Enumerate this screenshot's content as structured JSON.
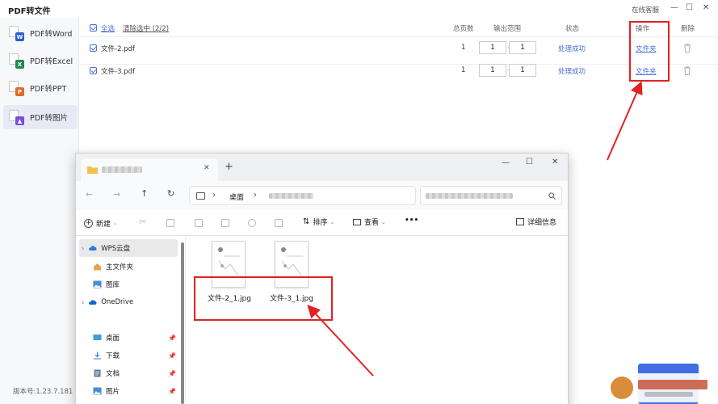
{
  "app": {
    "title": "PDF转文件",
    "online_service": "在线客服",
    "version": "版本号:1.23.7.181"
  },
  "sidebar": {
    "items": [
      {
        "label": "PDF转Word",
        "badge": "W",
        "color": "#2b5fd6"
      },
      {
        "label": "PDF转Excel",
        "badge": "X",
        "color": "#1f8a4c"
      },
      {
        "label": "PDF转PPT",
        "badge": "P",
        "color": "#e06b2b"
      },
      {
        "label": "PDF转图片",
        "badge": "▲",
        "color": "#7a4fd6"
      }
    ]
  },
  "table": {
    "select_all": "全选",
    "clear_selection": "清除选中 (2/2)",
    "headers": {
      "pages": "总页数",
      "range": "输出范围",
      "status": "状态",
      "action": "操作",
      "delete": "删除"
    },
    "rows": [
      {
        "name": "文件-2.pdf",
        "pages": "1",
        "from": "1",
        "dash": "-",
        "to": "1",
        "status": "处理成功",
        "action": "文件夹"
      },
      {
        "name": "文件-3.pdf",
        "pages": "1",
        "from": "1",
        "dash": "-",
        "to": "1",
        "status": "处理成功",
        "action": "文件夹"
      }
    ]
  },
  "explorer": {
    "new_tab": "+",
    "breadcrumb": {
      "root": "桌面",
      "sep": "›"
    },
    "toolbar": {
      "new": "新建",
      "sort": "排序",
      "view": "查看",
      "more": "•••",
      "details": "详细信息"
    },
    "nav": [
      {
        "label": "WPS云盘",
        "icon": "cloud-icon",
        "pinned": false
      },
      {
        "label": "主文件夹",
        "icon": "home-icon",
        "pinned": false
      },
      {
        "label": "图库",
        "icon": "gallery-icon",
        "pinned": false
      },
      {
        "label": "OneDrive",
        "icon": "cloud-icon",
        "pinned": false
      },
      {
        "label": "桌面",
        "icon": "desktop-icon",
        "pinned": true
      },
      {
        "label": "下载",
        "icon": "download-icon",
        "pinned": true
      },
      {
        "label": "文档",
        "icon": "document-icon",
        "pinned": true
      },
      {
        "label": "图片",
        "icon": "image-icon",
        "pinned": true
      }
    ],
    "files": [
      {
        "name": "文件-2_1.jpg"
      },
      {
        "name": "文件-3_1.jpg"
      }
    ]
  },
  "colors": {
    "accent": "#4a6fd6",
    "highlight": "#e02222"
  }
}
